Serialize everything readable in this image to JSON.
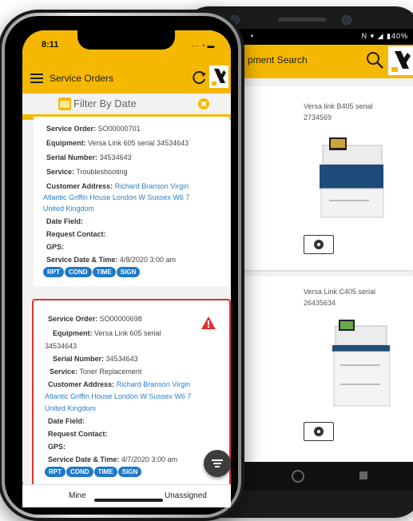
{
  "android": {
    "status": {
      "left_dot": "•",
      "right": "N ▾ ◢ ▮40%"
    },
    "title": "pment Search",
    "icons": {
      "search": "search-icon",
      "logo": "brand-logo-icon"
    },
    "products": [
      {
        "name": "Versa link B405 serial 2734569"
      },
      {
        "name": "Versa Link C405 serial 26435634"
      }
    ]
  },
  "iphone": {
    "time": "8:11",
    "status": "⋯ ◔ ▬",
    "header": {
      "title": "Service Orders"
    },
    "filter": {
      "label": "Filter By Date"
    },
    "orders": [
      {
        "service_order_label": "Service Order:",
        "service_order": "SO00000701",
        "equipment_label": "Equipment:",
        "equipment": "Versa Link 605 serial 34534643",
        "serial_label": "Serial Number:",
        "serial": "34534643",
        "service_label": "Service:",
        "service": "Troubleshooting",
        "address_label": "Customer Address:",
        "address_1": "Richard Branson Virgin",
        "address_2": "Atlantic Griffin House London W Sussex W6 7",
        "address_3": "United Kingdom",
        "date_field_label": "Date Field:",
        "request_contact_label": "Request Contact:",
        "gps_label": "GPS:",
        "datetime_label": "Service Date & Time:",
        "datetime": "4/8/2020 3:00 am",
        "tags": [
          "RPT",
          "COND",
          "TIME",
          "SIGN"
        ]
      },
      {
        "service_order_label": "Service Order:",
        "service_order": "SO00000698",
        "equipment_label": "Equipment:",
        "equipment_1": "Versa Link 605 serial",
        "equipment_2": "34534643",
        "serial_label": "Serial Number:",
        "serial": "34534643",
        "service_label": "Service:",
        "service": "Toner Replacement",
        "address_label": "Customer Address:",
        "address_1": "Richard Branson Virgin",
        "address_2": "Atlantic Griffin House London W Sussex W6 7",
        "address_3": "United Kingdom",
        "date_field_label": "Date Field:",
        "request_contact_label": "Request Contact:",
        "gps_label": "GPS:",
        "datetime_label": "Service Date & Time:",
        "datetime": "4/7/2020 3:00 am",
        "tags": [
          "RPT",
          "COND",
          "TIME",
          "SIGN"
        ],
        "alert": "warning-icon"
      }
    ],
    "tabs": {
      "mine": "Mine",
      "unassigned": "Unassigned"
    }
  },
  "colors": {
    "brand": "#f5b800",
    "tag": "#1e79c9",
    "alert": "#e03030",
    "link": "#2a7fc8"
  }
}
